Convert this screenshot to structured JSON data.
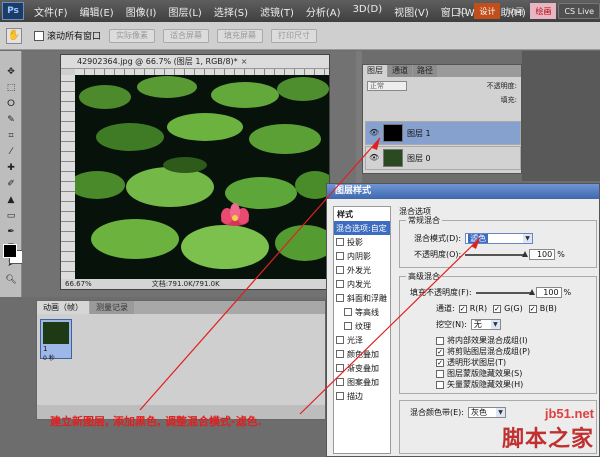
{
  "menubar": {
    "logo": "Ps",
    "items": [
      "文件(F)",
      "编辑(E)",
      "图像(I)",
      "图层(L)",
      "选择(S)",
      "滤镜(T)",
      "分析(A)",
      "3D(D)",
      "视图(V)",
      "窗口(W)",
      "帮助(H)"
    ],
    "workspace_buttons": [
      "3D",
      "设计",
      "动画",
      "绘画"
    ],
    "cs_live": "CS Live"
  },
  "options": {
    "checkbox_label": "滚动所有窗口",
    "buttons": [
      "实际像素",
      "适合屏幕",
      "填充屏幕",
      "打印尺寸"
    ]
  },
  "document": {
    "tab_title": "42902364.jpg @ 66.7% (图层 1, RGB/8)*",
    "zoom": "66.67%",
    "doc_size": "文档:791.0K/791.0K"
  },
  "animation_panel": {
    "tabs": [
      "动画（帧）",
      "测量记录"
    ],
    "frame_number": "1",
    "frame_time": "0 秒"
  },
  "layers_panel": {
    "tabs": [
      "图层",
      "通道",
      "路径"
    ],
    "blend_mode": "正常",
    "opacity_label": "不透明度:",
    "fill_label": "填充:",
    "layers": [
      {
        "name": "图层 1",
        "selected": true
      },
      {
        "name": "图层 0",
        "selected": false
      }
    ]
  },
  "layer_style": {
    "title": "图层样式",
    "styles_heading": "样式",
    "styles": [
      {
        "label": "混合选项:自定",
        "type": "active"
      },
      {
        "label": "投影",
        "checked": false
      },
      {
        "label": "内阴影",
        "checked": false
      },
      {
        "label": "外发光",
        "checked": false
      },
      {
        "label": "内发光",
        "checked": false
      },
      {
        "label": "斜面和浮雕",
        "checked": false
      },
      {
        "label": "等高线",
        "checked": false,
        "indent": true
      },
      {
        "label": "纹理",
        "checked": false,
        "indent": true
      },
      {
        "label": "光泽",
        "checked": false
      },
      {
        "label": "颜色叠加",
        "checked": false
      },
      {
        "label": "渐变叠加",
        "checked": false
      },
      {
        "label": "图案叠加",
        "checked": false
      },
      {
        "label": "描边",
        "checked": false
      }
    ],
    "blend_options_title": "混合选项",
    "general_blend_title": "常规混合",
    "blend_mode_label": "混合模式(D):",
    "blend_mode_value": "滤色",
    "opacity_label": "不透明度(O):",
    "opacity_value": "100",
    "percent": "%",
    "advanced_title": "高级混合",
    "fill_opacity_label": "填充不透明度(F):",
    "fill_opacity_value": "100",
    "channels_label": "通道:",
    "channel_r": "R(R)",
    "channel_g": "G(G)",
    "channel_b": "B(B)",
    "knockout_label": "挖空(N):",
    "knockout_value": "无",
    "options": [
      {
        "label": "将内部效果混合成组(I)",
        "checked": false
      },
      {
        "label": "将剪贴图层混合成组(P)",
        "checked": true
      },
      {
        "label": "透明形状图层(T)",
        "checked": true
      },
      {
        "label": "图层蒙版隐藏效果(S)",
        "checked": false
      },
      {
        "label": "矢量蒙版隐藏效果(H)",
        "checked": false
      }
    ],
    "blend_if_label": "混合颜色带(E):",
    "blend_if_value": "灰色"
  },
  "annotation": "建立新图层, 添加黑色, 调整混合模式-滤色.",
  "watermark": {
    "url": "jb51.net",
    "name": "脚本之家"
  },
  "colors": {
    "accent": "#3d6cc0",
    "annotation": "#e02020",
    "title_bar": "#4e77bd"
  }
}
